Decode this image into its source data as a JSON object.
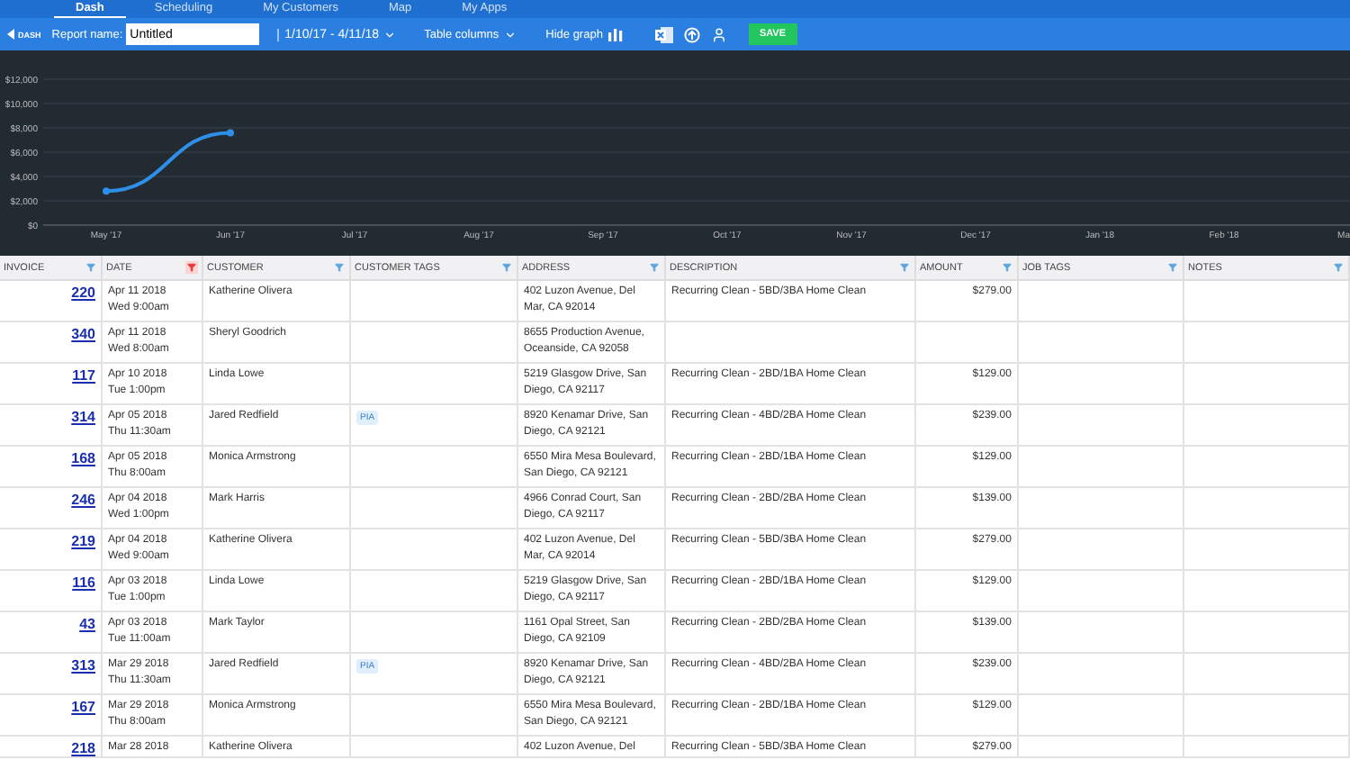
{
  "nav_tabs": [
    {
      "label": "Dash",
      "selected": true
    },
    {
      "label": "Scheduling",
      "selected": false
    },
    {
      "label": "My Customers",
      "selected": false
    },
    {
      "label": "Map",
      "selected": false
    },
    {
      "label": "My Apps",
      "selected": false
    }
  ],
  "toolbar": {
    "back_label": "DASH",
    "report_name_label": "Report name:",
    "report_name_value": "Untitled",
    "date_range": "1/10/17 - 4/11/18",
    "table_columns": "Table columns",
    "hide_graph": "Hide graph",
    "save": "SAVE"
  },
  "chart_data": {
    "type": "line",
    "categories": [
      "May '17",
      "Jun '17",
      "Jul '17",
      "Aug '17",
      "Sep '17",
      "Oct '17",
      "Nov '17",
      "Dec '17",
      "Jan '18",
      "Feb '18",
      "Ma"
    ],
    "grid": true,
    "series": [
      {
        "color": "#2e8fe8",
        "marker": true,
        "values": [
          2800,
          7600,
          null,
          null,
          null,
          null,
          null,
          null,
          null,
          null,
          null
        ]
      }
    ],
    "ylim": [
      0,
      12000
    ],
    "yticks": [
      {
        "value": 0,
        "label": "$0"
      },
      {
        "value": 2000,
        "label": "$2,000"
      },
      {
        "value": 4000,
        "label": "$4,000"
      },
      {
        "value": 6000,
        "label": "$6,000"
      },
      {
        "value": 8000,
        "label": "$8,000"
      },
      {
        "value": 10000,
        "label": "$10,000"
      },
      {
        "value": 12000,
        "label": "$12,000"
      }
    ]
  },
  "table": {
    "columns": [
      {
        "label": "INVOICE",
        "filtered": false
      },
      {
        "label": "DATE",
        "filtered": true
      },
      {
        "label": "CUSTOMER",
        "filtered": false
      },
      {
        "label": "CUSTOMER TAGS",
        "filtered": false
      },
      {
        "label": "ADDRESS",
        "filtered": false
      },
      {
        "label": "DESCRIPTION",
        "filtered": false
      },
      {
        "label": "AMOUNT",
        "filtered": false
      },
      {
        "label": "JOB TAGS",
        "filtered": false
      },
      {
        "label": "NOTES",
        "filtered": false
      }
    ],
    "rows": [
      {
        "invoice": "220",
        "date": "Apr 11 2018",
        "time": "Wed 9:00am",
        "customer": "Katherine Olivera",
        "tag": "",
        "address": "402 Luzon Avenue, Del Mar, CA 92014",
        "description": "Recurring Clean - 5BD/3BA Home Clean",
        "amount": "$279.00"
      },
      {
        "invoice": "340",
        "date": "Apr 11 2018",
        "time": "Wed 8:00am",
        "customer": "Sheryl Goodrich",
        "tag": "",
        "address": "8655 Production Avenue, Oceanside, CA 92058",
        "description": "",
        "amount": ""
      },
      {
        "invoice": "117",
        "date": "Apr 10 2018",
        "time": "Tue 1:00pm",
        "customer": "Linda Lowe",
        "tag": "",
        "address": "5219 Glasgow Drive, San Diego, CA 92117",
        "description": "Recurring Clean - 2BD/1BA Home Clean",
        "amount": "$129.00"
      },
      {
        "invoice": "314",
        "date": "Apr 05 2018",
        "time": "Thu 11:30am",
        "customer": "Jared Redfield",
        "tag": "PIA",
        "address": "8920 Kenamar Drive, San Diego, CA 92121",
        "description": "Recurring Clean - 4BD/2BA Home Clean",
        "amount": "$239.00"
      },
      {
        "invoice": "168",
        "date": "Apr 05 2018",
        "time": "Thu 8:00am",
        "customer": "Monica Armstrong",
        "tag": "",
        "address": "6550 Mira Mesa Boulevard, San Diego, CA 92121",
        "description": "Recurring Clean - 2BD/1BA Home Clean",
        "amount": "$129.00"
      },
      {
        "invoice": "246",
        "date": "Apr 04 2018",
        "time": "Wed 1:00pm",
        "customer": "Mark Harris",
        "tag": "",
        "address": "4966 Conrad Court, San Diego, CA 92117",
        "description": "Recurring Clean - 2BD/2BA Home Clean",
        "amount": "$139.00"
      },
      {
        "invoice": "219",
        "date": "Apr 04 2018",
        "time": "Wed 9:00am",
        "customer": "Katherine Olivera",
        "tag": "",
        "address": "402 Luzon Avenue, Del Mar, CA 92014",
        "description": "Recurring Clean - 5BD/3BA Home Clean",
        "amount": "$279.00"
      },
      {
        "invoice": "116",
        "date": "Apr 03 2018",
        "time": "Tue 1:00pm",
        "customer": "Linda Lowe",
        "tag": "",
        "address": "5219 Glasgow Drive, San Diego, CA 92117",
        "description": "Recurring Clean - 2BD/1BA Home Clean",
        "amount": "$129.00"
      },
      {
        "invoice": "43",
        "date": "Apr 03 2018",
        "time": "Tue 11:00am",
        "customer": "Mark Taylor",
        "tag": "",
        "address": "1161 Opal Street, San Diego, CA 92109",
        "description": "Recurring Clean - 2BD/2BA Home Clean",
        "amount": "$139.00"
      },
      {
        "invoice": "313",
        "date": "Mar 29 2018",
        "time": "Thu 11:30am",
        "customer": "Jared Redfield",
        "tag": "PIA",
        "address": "8920 Kenamar Drive, San Diego, CA 92121",
        "description": "Recurring Clean - 4BD/2BA Home Clean",
        "amount": "$239.00"
      },
      {
        "invoice": "167",
        "date": "Mar 29 2018",
        "time": "Thu 8:00am",
        "customer": "Monica Armstrong",
        "tag": "",
        "address": "6550 Mira Mesa Boulevard, San Diego, CA 92121",
        "description": "Recurring Clean - 2BD/1BA Home Clean",
        "amount": "$129.00"
      },
      {
        "invoice": "218",
        "date": "Mar 28 2018",
        "time": "",
        "customer": "Katherine Olivera",
        "tag": "",
        "address": "402 Luzon Avenue, Del",
        "description": "Recurring Clean - 5BD/3BA Home Clean",
        "amount": "$279.00"
      }
    ]
  }
}
